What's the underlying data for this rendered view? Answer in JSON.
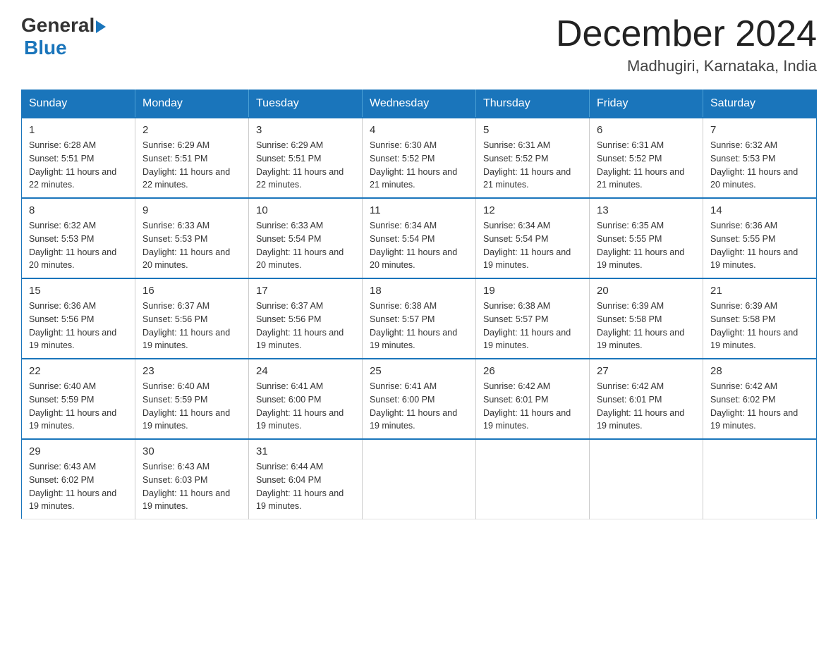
{
  "logo": {
    "general": "General",
    "blue": "Blue"
  },
  "title": "December 2024",
  "location": "Madhugiri, Karnataka, India",
  "days_of_week": [
    "Sunday",
    "Monday",
    "Tuesday",
    "Wednesday",
    "Thursday",
    "Friday",
    "Saturday"
  ],
  "weeks": [
    [
      {
        "day": "1",
        "sunrise": "6:28 AM",
        "sunset": "5:51 PM",
        "daylight": "11 hours and 22 minutes."
      },
      {
        "day": "2",
        "sunrise": "6:29 AM",
        "sunset": "5:51 PM",
        "daylight": "11 hours and 22 minutes."
      },
      {
        "day": "3",
        "sunrise": "6:29 AM",
        "sunset": "5:51 PM",
        "daylight": "11 hours and 22 minutes."
      },
      {
        "day": "4",
        "sunrise": "6:30 AM",
        "sunset": "5:52 PM",
        "daylight": "11 hours and 21 minutes."
      },
      {
        "day": "5",
        "sunrise": "6:31 AM",
        "sunset": "5:52 PM",
        "daylight": "11 hours and 21 minutes."
      },
      {
        "day": "6",
        "sunrise": "6:31 AM",
        "sunset": "5:52 PM",
        "daylight": "11 hours and 21 minutes."
      },
      {
        "day": "7",
        "sunrise": "6:32 AM",
        "sunset": "5:53 PM",
        "daylight": "11 hours and 20 minutes."
      }
    ],
    [
      {
        "day": "8",
        "sunrise": "6:32 AM",
        "sunset": "5:53 PM",
        "daylight": "11 hours and 20 minutes."
      },
      {
        "day": "9",
        "sunrise": "6:33 AM",
        "sunset": "5:53 PM",
        "daylight": "11 hours and 20 minutes."
      },
      {
        "day": "10",
        "sunrise": "6:33 AM",
        "sunset": "5:54 PM",
        "daylight": "11 hours and 20 minutes."
      },
      {
        "day": "11",
        "sunrise": "6:34 AM",
        "sunset": "5:54 PM",
        "daylight": "11 hours and 20 minutes."
      },
      {
        "day": "12",
        "sunrise": "6:34 AM",
        "sunset": "5:54 PM",
        "daylight": "11 hours and 19 minutes."
      },
      {
        "day": "13",
        "sunrise": "6:35 AM",
        "sunset": "5:55 PM",
        "daylight": "11 hours and 19 minutes."
      },
      {
        "day": "14",
        "sunrise": "6:36 AM",
        "sunset": "5:55 PM",
        "daylight": "11 hours and 19 minutes."
      }
    ],
    [
      {
        "day": "15",
        "sunrise": "6:36 AM",
        "sunset": "5:56 PM",
        "daylight": "11 hours and 19 minutes."
      },
      {
        "day": "16",
        "sunrise": "6:37 AM",
        "sunset": "5:56 PM",
        "daylight": "11 hours and 19 minutes."
      },
      {
        "day": "17",
        "sunrise": "6:37 AM",
        "sunset": "5:56 PM",
        "daylight": "11 hours and 19 minutes."
      },
      {
        "day": "18",
        "sunrise": "6:38 AM",
        "sunset": "5:57 PM",
        "daylight": "11 hours and 19 minutes."
      },
      {
        "day": "19",
        "sunrise": "6:38 AM",
        "sunset": "5:57 PM",
        "daylight": "11 hours and 19 minutes."
      },
      {
        "day": "20",
        "sunrise": "6:39 AM",
        "sunset": "5:58 PM",
        "daylight": "11 hours and 19 minutes."
      },
      {
        "day": "21",
        "sunrise": "6:39 AM",
        "sunset": "5:58 PM",
        "daylight": "11 hours and 19 minutes."
      }
    ],
    [
      {
        "day": "22",
        "sunrise": "6:40 AM",
        "sunset": "5:59 PM",
        "daylight": "11 hours and 19 minutes."
      },
      {
        "day": "23",
        "sunrise": "6:40 AM",
        "sunset": "5:59 PM",
        "daylight": "11 hours and 19 minutes."
      },
      {
        "day": "24",
        "sunrise": "6:41 AM",
        "sunset": "6:00 PM",
        "daylight": "11 hours and 19 minutes."
      },
      {
        "day": "25",
        "sunrise": "6:41 AM",
        "sunset": "6:00 PM",
        "daylight": "11 hours and 19 minutes."
      },
      {
        "day": "26",
        "sunrise": "6:42 AM",
        "sunset": "6:01 PM",
        "daylight": "11 hours and 19 minutes."
      },
      {
        "day": "27",
        "sunrise": "6:42 AM",
        "sunset": "6:01 PM",
        "daylight": "11 hours and 19 minutes."
      },
      {
        "day": "28",
        "sunrise": "6:42 AM",
        "sunset": "6:02 PM",
        "daylight": "11 hours and 19 minutes."
      }
    ],
    [
      {
        "day": "29",
        "sunrise": "6:43 AM",
        "sunset": "6:02 PM",
        "daylight": "11 hours and 19 minutes."
      },
      {
        "day": "30",
        "sunrise": "6:43 AM",
        "sunset": "6:03 PM",
        "daylight": "11 hours and 19 minutes."
      },
      {
        "day": "31",
        "sunrise": "6:44 AM",
        "sunset": "6:04 PM",
        "daylight": "11 hours and 19 minutes."
      },
      null,
      null,
      null,
      null
    ]
  ]
}
